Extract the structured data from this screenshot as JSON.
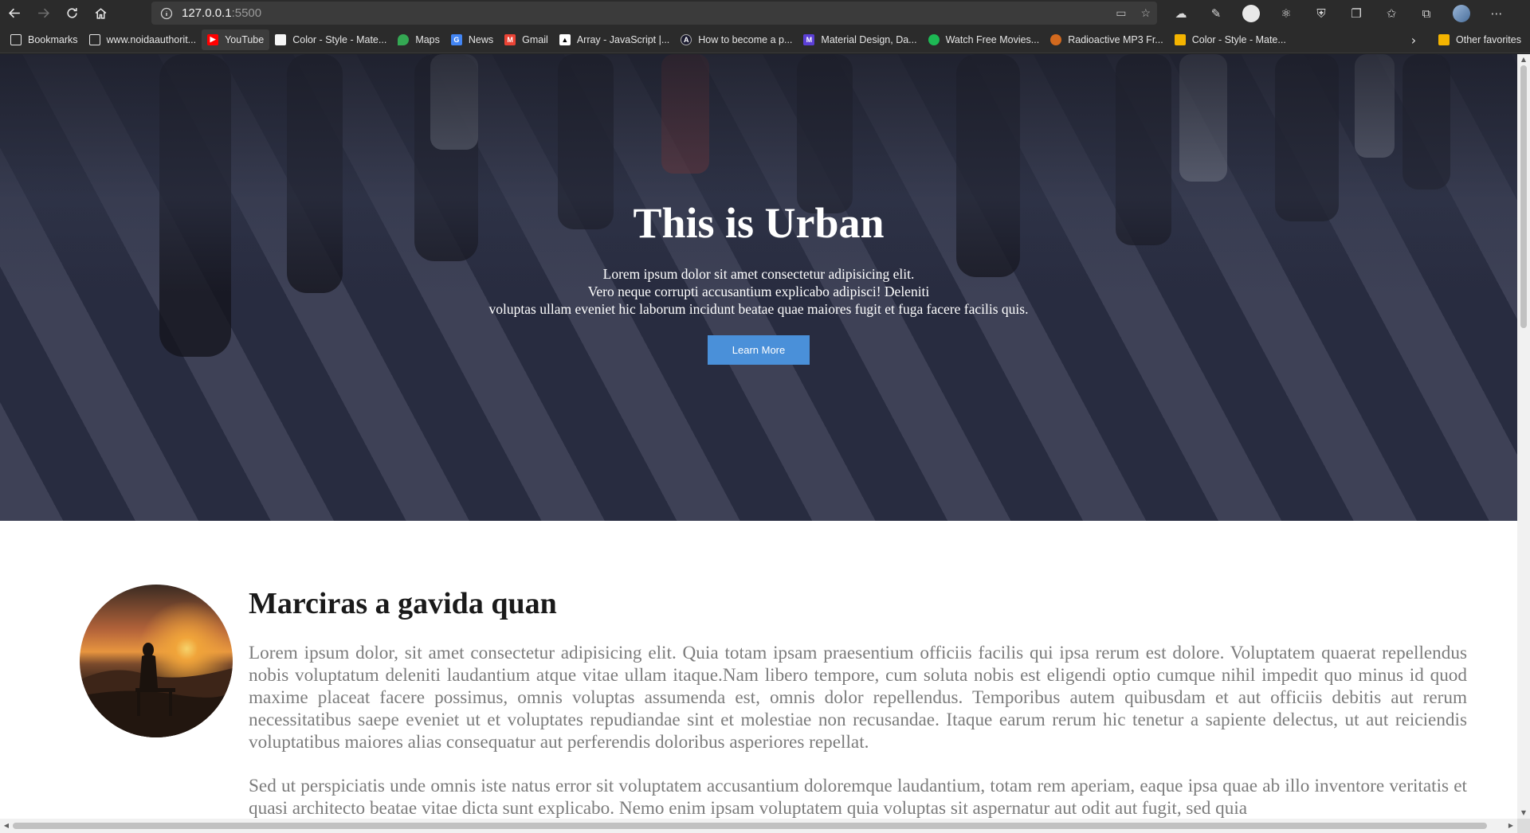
{
  "browser": {
    "url_host": "127.0.0.1",
    "url_port": ":5500",
    "bookmarks": [
      {
        "label": "Bookmarks",
        "icon": "bookmark-page-icon",
        "color": "#e6e6e6"
      },
      {
        "label": "www.noidaauthorit...",
        "icon": "page-icon",
        "color": "#e6e6e6"
      },
      {
        "label": "YouTube",
        "icon": "youtube-icon",
        "color": "#ff0000"
      },
      {
        "label": "Color - Style - Mate...",
        "icon": "material-icon",
        "color": "#f5f5f5"
      },
      {
        "label": "Maps",
        "icon": "maps-icon",
        "color": "#34a853"
      },
      {
        "label": "News",
        "icon": "news-icon",
        "color": "#4285f4"
      },
      {
        "label": "Gmail",
        "icon": "gmail-icon",
        "color": "#ea4335"
      },
      {
        "label": "Array - JavaScript |...",
        "icon": "mdn-icon",
        "color": "#ffffff"
      },
      {
        "label": "How to become a p...",
        "icon": "a-icon",
        "color": "#1a1a2e"
      },
      {
        "label": "Material Design, Da...",
        "icon": "md-icon",
        "color": "#5b3fd6"
      },
      {
        "label": "Watch Free Movies...",
        "icon": "movie-icon",
        "color": "#1db954"
      },
      {
        "label": "Radioactive MP3 Fr...",
        "icon": "paw-icon",
        "color": "#d2691e"
      },
      {
        "label": "Color - Style - Mate...",
        "icon": "folder-color-icon",
        "color": "#f4b400"
      }
    ],
    "other_favorites": "Other favorites"
  },
  "hero": {
    "title": "This is Urban",
    "line1": "Lorem ipsum dolor sit amet consectetur adipisicing elit.",
    "line2": "Vero neque corrupti accusantium explicabo adipisci! Deleniti",
    "line3": "voluptas ullam eveniet hic laborum incidunt beatae quae maiores fugit et fuga facere facilis quis.",
    "button": "Learn More",
    "button_color": "#4a90d9"
  },
  "section": {
    "title": "Marciras a gavida quan",
    "paragraph1": "Lorem ipsum dolor, sit amet consectetur adipisicing elit. Quia totam ipsam praesentium officiis facilis qui ipsa rerum est dolore. Voluptatem quaerat repellendus nobis voluptatum deleniti laudantium atque vitae ullam itaque.Nam libero tempore, cum soluta nobis est eligendi optio cumque nihil impedit quo minus id quod maxime placeat facere possimus, omnis voluptas assumenda est, omnis dolor repellendus. Temporibus autem quibusdam et aut officiis debitis aut rerum necessitatibus saepe eveniet ut et voluptates repudiandae sint et molestiae non recusandae. Itaque earum rerum hic tenetur a sapiente delectus, ut aut reiciendis voluptatibus maiores alias consequatur aut perferendis doloribus asperiores repellat.",
    "paragraph2": "Sed ut perspiciatis unde omnis iste natus error sit voluptatem accusantium doloremque laudantium, totam rem aperiam, eaque ipsa quae ab illo inventore veritatis et quasi architecto beatae vitae dicta sunt explicabo. Nemo enim ipsam voluptatem quia voluptas sit aspernatur aut odit aut fugit, sed quia"
  }
}
